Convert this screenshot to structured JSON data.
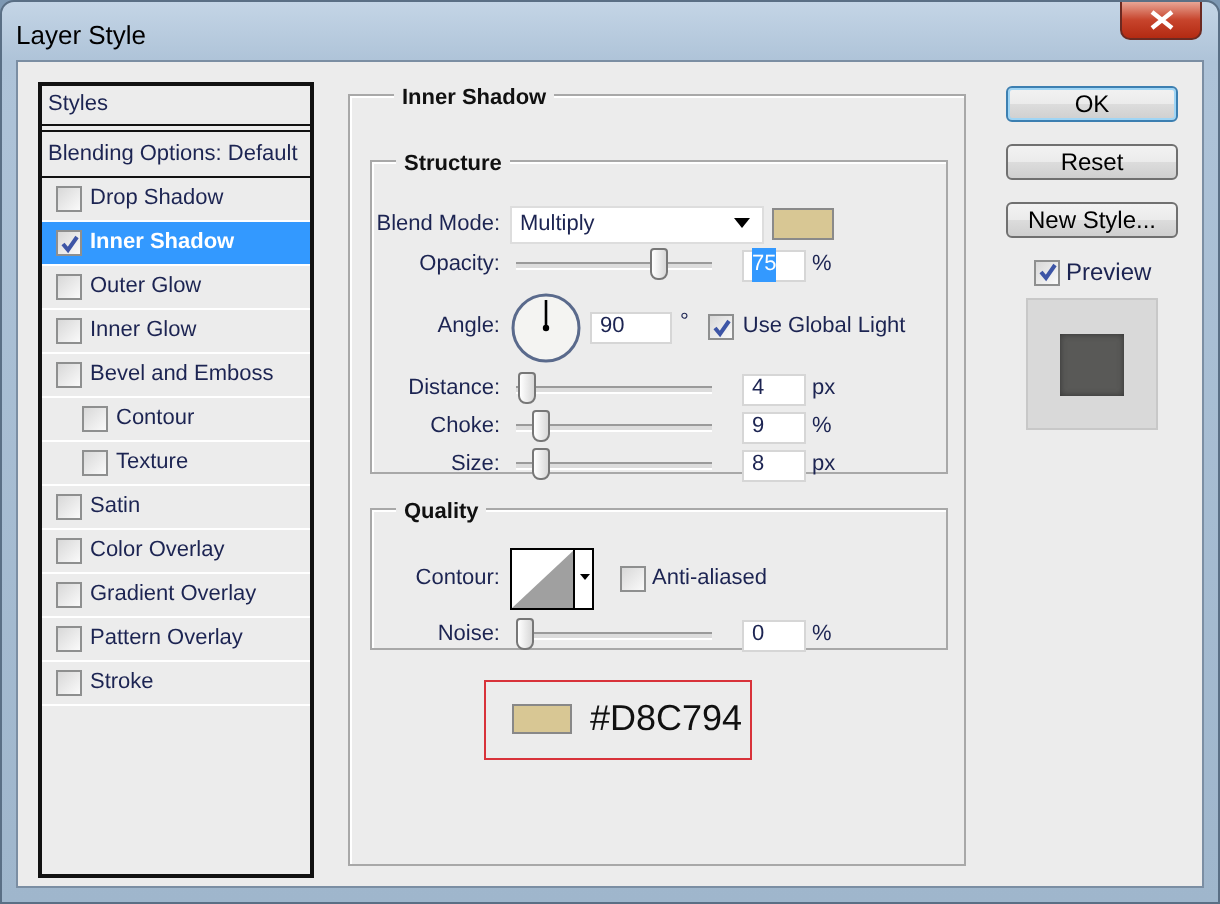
{
  "window": {
    "title": "Layer Style"
  },
  "styles_list": {
    "header": "Styles",
    "blending_options": "Blending Options: Default",
    "items": [
      {
        "label": "Drop Shadow",
        "checked": false,
        "selected": false
      },
      {
        "label": "Inner Shadow",
        "checked": true,
        "selected": true
      },
      {
        "label": "Outer Glow",
        "checked": false,
        "selected": false
      },
      {
        "label": "Inner Glow",
        "checked": false,
        "selected": false
      },
      {
        "label": "Bevel and Emboss",
        "checked": false,
        "selected": false,
        "children": [
          {
            "label": "Contour",
            "checked": false,
            "selected": false
          },
          {
            "label": "Texture",
            "checked": false,
            "selected": false
          }
        ]
      },
      {
        "label": "Satin",
        "checked": false,
        "selected": false
      },
      {
        "label": "Color Overlay",
        "checked": false,
        "selected": false
      },
      {
        "label": "Gradient Overlay",
        "checked": false,
        "selected": false
      },
      {
        "label": "Pattern Overlay",
        "checked": false,
        "selected": false
      },
      {
        "label": "Stroke",
        "checked": false,
        "selected": false
      }
    ]
  },
  "inner_shadow": {
    "title": "Inner Shadow",
    "structure": {
      "title": "Structure",
      "blend_mode": {
        "label": "Blend Mode:",
        "value": "Multiply",
        "color": "#d8c794"
      },
      "opacity": {
        "label": "Opacity:",
        "level": 0.75,
        "value": "75",
        "text_selected": true,
        "unit": "%"
      },
      "angle": {
        "label": "Angle:",
        "value": "90",
        "unit": "°",
        "use_global_light": {
          "label": "Use Global Light",
          "checked": true
        }
      },
      "distance": {
        "label": "Distance:",
        "level": 0.016,
        "value": "4",
        "unit": "px"
      },
      "choke": {
        "label": "Choke:",
        "level": 0.09,
        "value": "9",
        "unit": "%"
      },
      "size": {
        "label": "Size:",
        "level": 0.09,
        "value": "8",
        "unit": "px"
      }
    },
    "quality": {
      "title": "Quality",
      "contour": {
        "label": "Contour:"
      },
      "anti_aliased": {
        "label": "Anti-aliased",
        "checked": false
      },
      "noise": {
        "label": "Noise:",
        "level": 0,
        "value": "0",
        "unit": "%"
      }
    },
    "color_sample": {
      "color": "#d8c794",
      "text": "#D8C794"
    }
  },
  "buttons": [
    {
      "label": "OK",
      "default": true
    },
    {
      "label": "Reset",
      "default": false
    },
    {
      "label": "New Style...",
      "default": false
    }
  ],
  "preview": {
    "label": "Preview",
    "checked": true
  }
}
